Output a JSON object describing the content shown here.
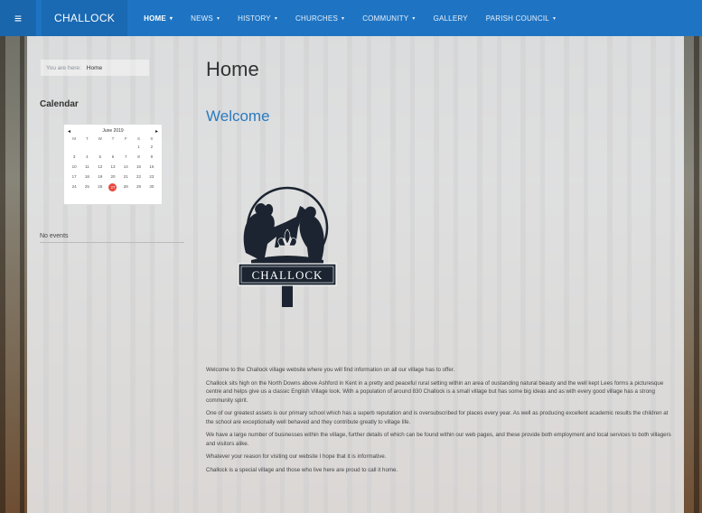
{
  "navbar": {
    "toggle_icon": "hamburger-icon",
    "brand": "CHALLOCK",
    "items": [
      {
        "label": "HOME",
        "caret": "▾",
        "active": true
      },
      {
        "label": "NEWS",
        "caret": "▾",
        "active": false
      },
      {
        "label": "HISTORY",
        "caret": "▾",
        "active": false
      },
      {
        "label": "CHURCHES",
        "caret": "▾",
        "active": false
      },
      {
        "label": "COMMUNITY",
        "caret": "▾",
        "active": false
      },
      {
        "label": "GALLERY",
        "caret": "",
        "active": false
      },
      {
        "label": "PARISH COUNCIL",
        "caret": "▾",
        "active": false
      }
    ],
    "color": "#1e74c3"
  },
  "breadcrumb": {
    "label": "You are here:",
    "current": "Home"
  },
  "calendar": {
    "heading": "Calendar",
    "month": "June 2019",
    "prev": "◂",
    "next": "▸",
    "days_of_week": [
      "M",
      "T",
      "W",
      "T",
      "F",
      "S",
      "S"
    ],
    "weeks": [
      [
        "",
        "",
        "",
        "",
        "",
        "1",
        "2"
      ],
      [
        "3",
        "4",
        "5",
        "6",
        "7",
        "8",
        "9"
      ],
      [
        "10",
        "11",
        "12",
        "13",
        "14",
        "15",
        "16"
      ],
      [
        "17",
        "18",
        "19",
        "20",
        "21",
        "22",
        "23"
      ],
      [
        "24",
        "25",
        "26",
        "27",
        "28",
        "29",
        "30"
      ]
    ],
    "today": "27",
    "today_color": "#e8473e"
  },
  "events": {
    "empty_text": "No events"
  },
  "main": {
    "title": "Home",
    "subtitle": "Welcome",
    "logo_text": "CHALLOCK",
    "paragraphs": [
      "Welcome to the Challock village website where you will find information on all our village has to offer.",
      "Challock sits high on the North Downs above Ashford in Kent in a pretty and peaceful rural setting within an area of oustanding natural beauty and the well kept Lees forms a picturesque centre and helps give us a classic English Village look. With a population of around 830 Challock is a small village but has some big ideas and as with every good village has a strong community spirit.",
      "One of our greatest assets is our primary school which has a superb reputation and is oversubscribed for places every year. As well as producing excellent academic results the children at the school are exceptionally well behaved and they contribute greatly to village life.",
      "We have a large number of businesses within the village, further details of which can be found within our web pages, and these provide both employment and local services to both villagers and visitors alike.",
      "Whatever your reason for visiting our website I hope that it is informative.",
      "Challock is a special village and those who live here are proud to call it home."
    ]
  }
}
